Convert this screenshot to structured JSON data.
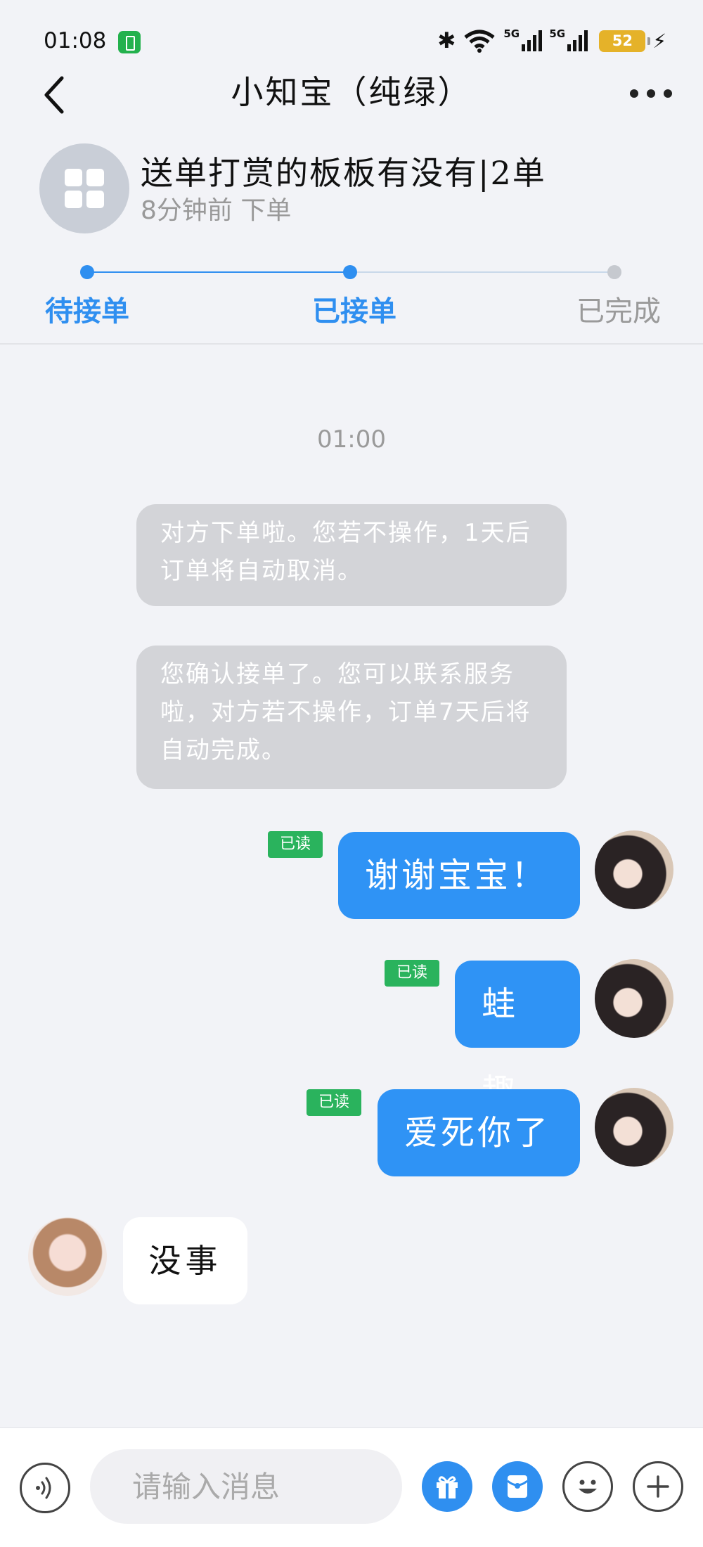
{
  "status_bar": {
    "time": "01:08",
    "battery": "52",
    "network_1": "5G",
    "network_2": "5G"
  },
  "header": {
    "title": "小知宝（纯绿）"
  },
  "order": {
    "title": "送单打赏的板板有没有|2单",
    "time": "8分钟前 下单"
  },
  "progress": {
    "steps": [
      {
        "label": "待接单",
        "state": "done"
      },
      {
        "label": "已接单",
        "state": "current"
      },
      {
        "label": "已完成",
        "state": "pending"
      }
    ]
  },
  "chat": {
    "timestamp": "01:00",
    "system_messages": [
      "对方下单啦。您若不操作，1天后订单将自动取消。",
      "您确认接单了。您可以联系服务啦，对方若不操作，订单7天后将自动完成。"
    ],
    "outgoing": [
      {
        "text": "谢谢宝宝！",
        "read": "已读"
      },
      {
        "text": "蛙趣",
        "read": "已读"
      },
      {
        "text": "爱死你了",
        "read": "已读"
      }
    ],
    "incoming": [
      {
        "text": "没事"
      }
    ]
  },
  "input_bar": {
    "placeholder": "请输入消息"
  },
  "colors": {
    "accent": "#2f8ff0",
    "read_tag": "#2ab35d",
    "system_bubble": "#d3d4d8",
    "background": "#f2f3f7"
  }
}
